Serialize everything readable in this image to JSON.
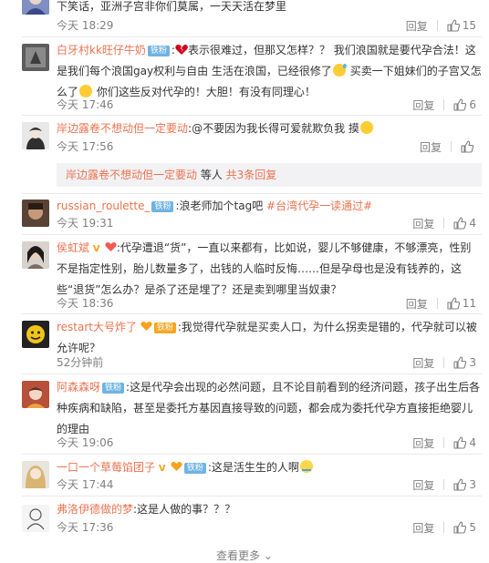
{
  "actions": {
    "reply_label": "回复"
  },
  "top_partial": {
    "text": "下笑话，亚洲子宫非你们莫属，一天天活在梦里",
    "time": "今天 18:29",
    "likes": "15"
  },
  "comments": [
    {
      "name": "白牙村kk旺仔牛奶",
      "badge": "铁粉",
      "segments": [
        "表示很难过，但那又怎样？？ 我们浪国就是要代孕合法！",
        "这是我们每个浪国gay权利与自由 生活在浪国，已经很修了",
        "买卖一下姐妹们的子宫又怎么了",
        "你们这些反对代孕的！大胆！有没有同理心！"
      ],
      "time": "今天 17:46",
      "likes": "6"
    },
    {
      "name": "岸边露卷不想动但一定要动",
      "text": "@不要因为我长得可爱就欺负我 摸",
      "time": "今天 17:56",
      "likes": "",
      "sub": {
        "name": "岸边露卷不想动但一定要动",
        "mid": " 等人 ",
        "count": "共3条回复"
      }
    },
    {
      "name": "russian_roulette_",
      "badge": "铁粉",
      "text": "浪老师加个tag吧 ",
      "tag": "#台湾代孕一读通过#",
      "time": "今天 19:31",
      "likes": "4"
    },
    {
      "name": "侯虹斌",
      "text": "代孕遭退“货”，一直以来都有，比如说，婴儿不够健康，不够漂亮，性别不是指定性别，胎儿数量多了，出钱的人临时反悔……但是孕母也是没有钱养的，这些“退货”怎么办？是杀了还是埋了？还是卖到哪里当奴隶？",
      "time": "今天 18:36",
      "likes": "11"
    },
    {
      "name": "restart大号炸了",
      "badge": "铁粉",
      "text": "我觉得代孕就是买卖人口，为什么拐卖是错的，代孕就可以被允许呢？",
      "time": "52分钟前",
      "likes": "3"
    },
    {
      "name": "阿森森呀",
      "badge": "铁粉",
      "text": "这是代孕会出现的必然问题，且不论目前看到的经济问题，孩子出生后各种疾病和缺陷，甚至是委托方基因直接导致的问题，都会成为委托代孕方直接拒绝婴儿的理由",
      "time": "今天 19:06",
      "likes": "4"
    },
    {
      "name": "一口一个草莓馅团子",
      "badge": "铁粉",
      "text": "这是活生生的人啊",
      "time": "今天 17:44",
      "likes": "3"
    },
    {
      "name": "弗洛伊德做的梦",
      "text": "这是人做的事？？？",
      "time": "今天 17:36",
      "likes": "5"
    }
  ],
  "more": {
    "label": "查看更多"
  },
  "colors": {
    "name": "#eb7350",
    "meta": "#808080",
    "text": "#333333",
    "badge": "#6fb3e3"
  }
}
